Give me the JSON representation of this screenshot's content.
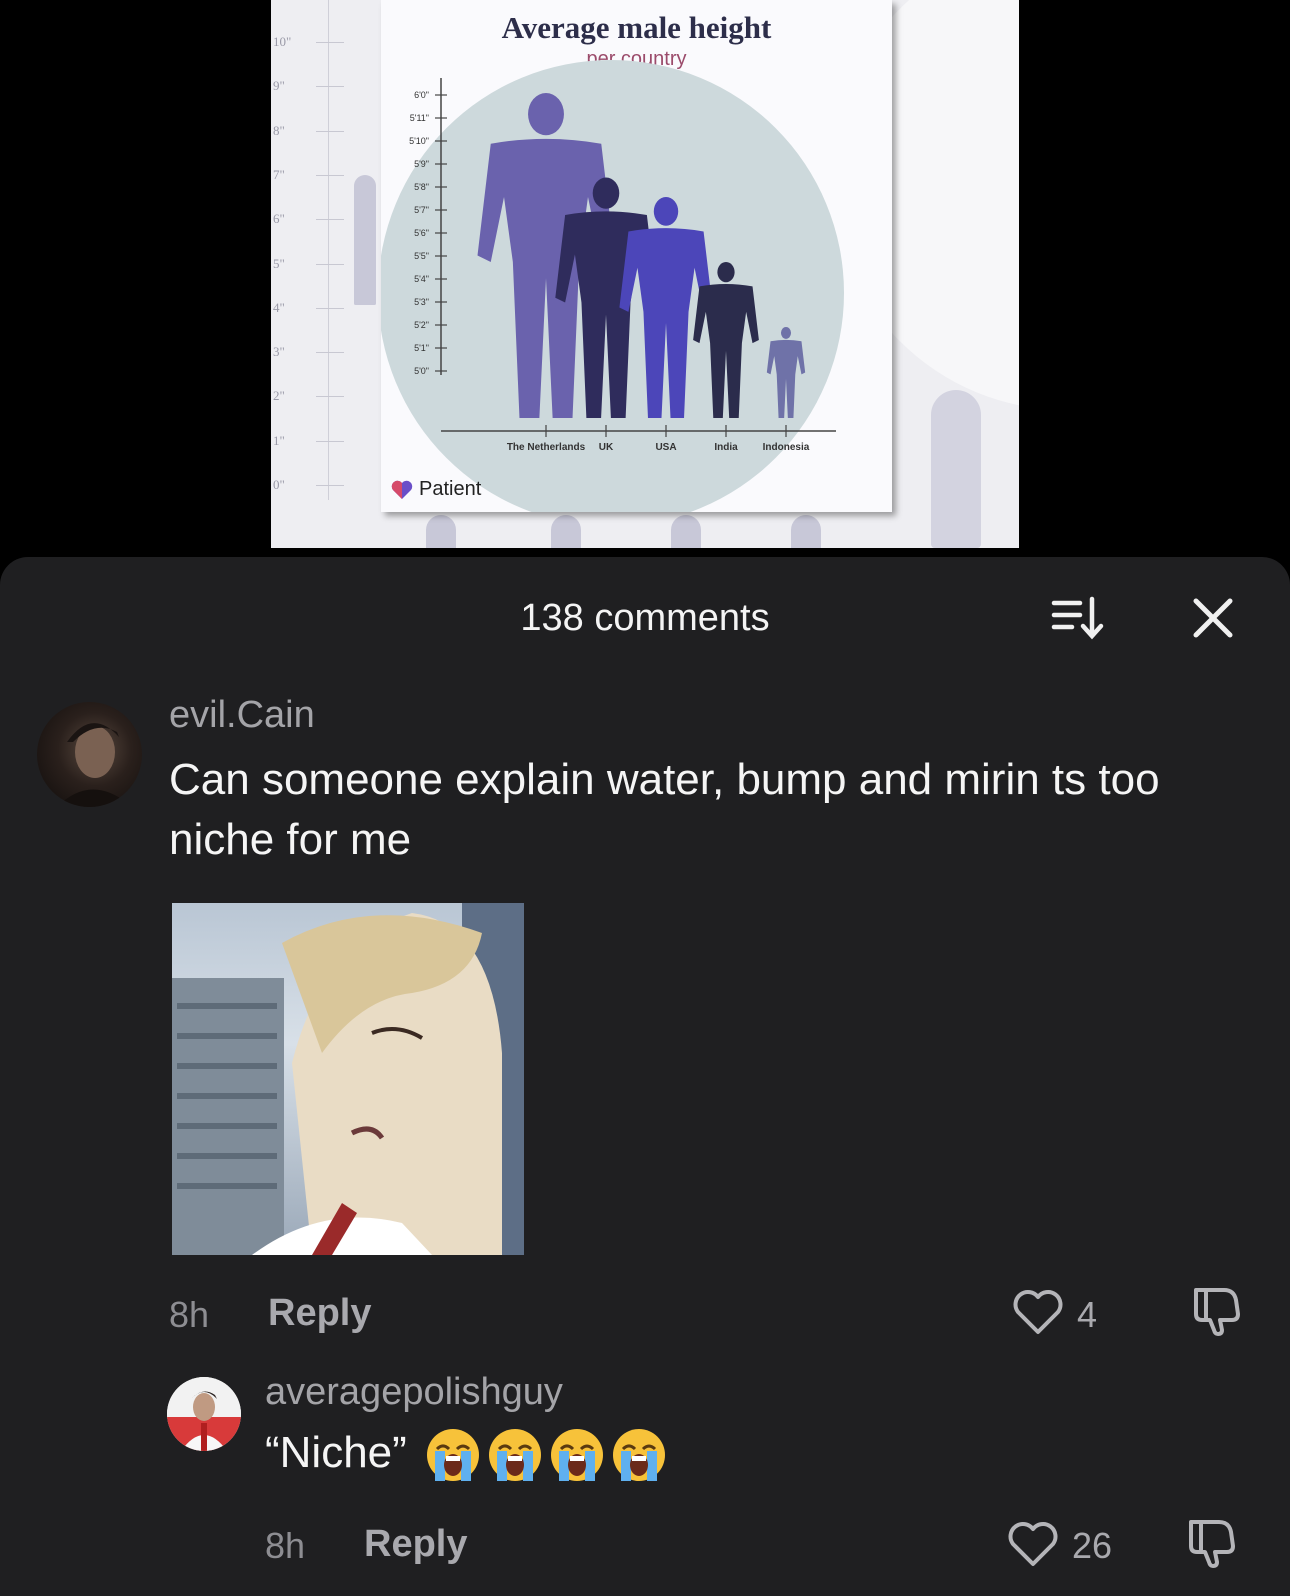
{
  "media": {
    "chart_title": "Average male height",
    "chart_subtitle": "per country",
    "brand": "Patient",
    "left_ruler_labels": [
      "10\"",
      "9\"",
      "8\"",
      "7\"",
      "6\"",
      "5\"",
      "4\"",
      "3\"",
      "2\"",
      "1\"",
      "0\""
    ]
  },
  "chart_data": {
    "type": "bar",
    "title": "Average male height",
    "subtitle": "per country",
    "categories": [
      "The Netherlands",
      "UK",
      "USA",
      "India",
      "Indonesia"
    ],
    "values": [
      "6'0\"",
      "5'9\"",
      "5'9\"",
      "5'5\"",
      "5'2\""
    ],
    "ytick_labels": [
      "6'0\"",
      "5'11\"",
      "5'10\"",
      "5'9\"",
      "5'8\"",
      "5'7\"",
      "5'6\"",
      "5'5\"",
      "5'4\"",
      "5'3\"",
      "5'2\"",
      "5'1\"",
      "5'0\""
    ],
    "colors": [
      "#6a62ad",
      "#2f2c5c",
      "#4c46b9",
      "#2b2c4c",
      "#6f72a8"
    ]
  },
  "sheet": {
    "comment_count": "138 comments",
    "sort_icon": "sort-icon",
    "close_icon": "close-icon"
  },
  "comments": [
    {
      "username": "evil.Cain",
      "text": "Can someone explain water, bump and mirin ts too niche for me",
      "time": "8h",
      "reply_label": "Reply",
      "likes": "4",
      "has_gif": true
    },
    {
      "username": "averagepolishguy",
      "text": "“Niche”",
      "emojis": "😭😭😭😭",
      "time": "8h",
      "reply_label": "Reply",
      "likes": "26"
    }
  ]
}
